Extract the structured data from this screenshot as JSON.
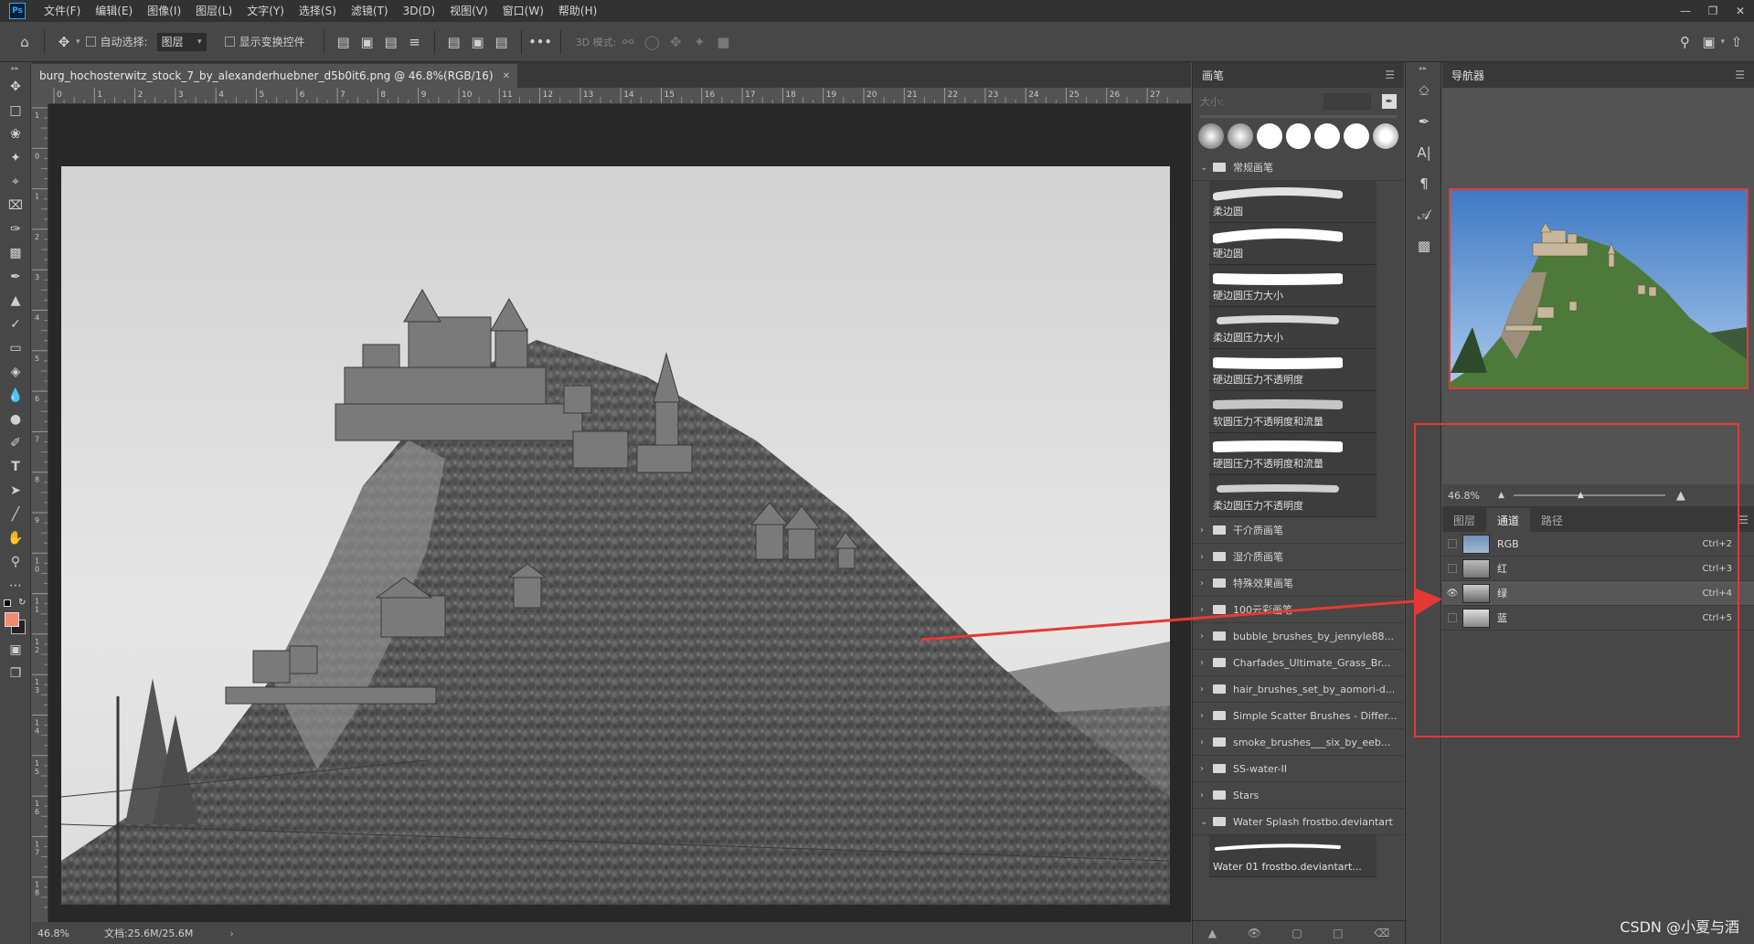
{
  "menu": {
    "logo": "Ps",
    "items": [
      "文件(F)",
      "编辑(E)",
      "图像(I)",
      "图层(L)",
      "文字(Y)",
      "选择(S)",
      "滤镜(T)",
      "3D(D)",
      "视图(V)",
      "窗口(W)",
      "帮助(H)"
    ]
  },
  "options": {
    "auto_select_label": "自动选择:",
    "auto_select_value": "图层",
    "show_transform_label": "显示变换控件",
    "mode_3d_label": "3D 模式:",
    "more": "•••"
  },
  "document": {
    "tab_title": "burg_hochosterwitz_stock_7_by_alexanderhuebner_d5b0it6.png @ 46.8%(RGB/16)",
    "ruler_h_labels": [
      "0",
      "1",
      "2",
      "3",
      "4",
      "5",
      "6",
      "7",
      "8",
      "9",
      "10",
      "11",
      "12",
      "13",
      "14",
      "15",
      "16",
      "17",
      "18",
      "19",
      "20",
      "21",
      "22",
      "23",
      "24",
      "25",
      "26",
      "27"
    ],
    "ruler_v_labels": [
      "1",
      "0",
      "1",
      "2",
      "3",
      "4",
      "5",
      "6",
      "7",
      "8",
      "9",
      "1 0",
      "1 1",
      "1 2",
      "1 3",
      "1 4",
      "1 5",
      "1 6",
      "1 7",
      "1 8"
    ],
    "zoom": "46.8%",
    "doc_size": "文档:25.6M/25.6M"
  },
  "brushes": {
    "title": "画笔",
    "size_label": "大小:",
    "general_folder": "常规画笔",
    "items": [
      "柔边圆",
      "硬边圆",
      "硬边圆压力大小",
      "柔边圆压力大小",
      "硬边圆压力不透明度",
      "软圆压力不透明度和流量",
      "硬圆压力不透明度和流量",
      "柔边圆压力不透明度"
    ],
    "folders": [
      "干介质画笔",
      "湿介质画笔",
      "特殊效果画笔",
      "100云彩画笔",
      "bubble_brushes_by_jennyle88...",
      "Charfades_Ultimate_Grass_Br...",
      "hair_brushes_set_by_aomori-d...",
      "Simple Scatter Brushes - Differ...",
      "smoke_brushes___six_by_eeb...",
      "SS-water-II",
      "Stars"
    ],
    "water_folder": "Water Splash frostbo.deviantart",
    "water_item": "Water 01 frostbo.deviantart..."
  },
  "navigator": {
    "title": "导航器",
    "zoom": "46.8%"
  },
  "channels": {
    "tabs": [
      "图层",
      "通道",
      "路径"
    ],
    "rows": [
      {
        "name": "RGB",
        "shortcut": "Ctrl+2",
        "visible": false
      },
      {
        "name": "红",
        "shortcut": "Ctrl+3",
        "visible": false
      },
      {
        "name": "绿",
        "shortcut": "Ctrl+4",
        "visible": true
      },
      {
        "name": "蓝",
        "shortcut": "Ctrl+5",
        "visible": false
      }
    ]
  },
  "watermark": "CSDN @小夏与酒",
  "colors": {
    "annotation": "#e53935",
    "foreground": "#f28a6b",
    "background": "#222222"
  }
}
